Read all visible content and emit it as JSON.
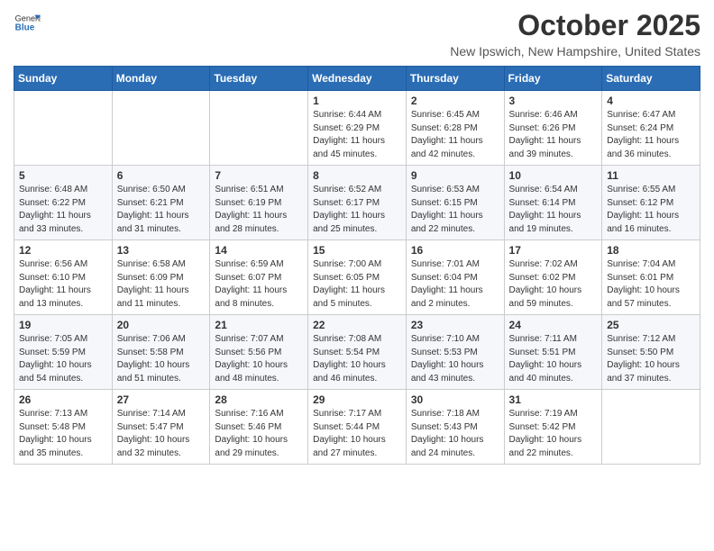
{
  "header": {
    "logo_general": "General",
    "logo_blue": "Blue",
    "month_title": "October 2025",
    "location": "New Ipswich, New Hampshire, United States"
  },
  "weekdays": [
    "Sunday",
    "Monday",
    "Tuesday",
    "Wednesday",
    "Thursday",
    "Friday",
    "Saturday"
  ],
  "weeks": [
    [
      {
        "day": "",
        "sunrise": "",
        "sunset": "",
        "daylight": ""
      },
      {
        "day": "",
        "sunrise": "",
        "sunset": "",
        "daylight": ""
      },
      {
        "day": "",
        "sunrise": "",
        "sunset": "",
        "daylight": ""
      },
      {
        "day": "1",
        "sunrise": "Sunrise: 6:44 AM",
        "sunset": "Sunset: 6:29 PM",
        "daylight": "Daylight: 11 hours and 45 minutes."
      },
      {
        "day": "2",
        "sunrise": "Sunrise: 6:45 AM",
        "sunset": "Sunset: 6:28 PM",
        "daylight": "Daylight: 11 hours and 42 minutes."
      },
      {
        "day": "3",
        "sunrise": "Sunrise: 6:46 AM",
        "sunset": "Sunset: 6:26 PM",
        "daylight": "Daylight: 11 hours and 39 minutes."
      },
      {
        "day": "4",
        "sunrise": "Sunrise: 6:47 AM",
        "sunset": "Sunset: 6:24 PM",
        "daylight": "Daylight: 11 hours and 36 minutes."
      }
    ],
    [
      {
        "day": "5",
        "sunrise": "Sunrise: 6:48 AM",
        "sunset": "Sunset: 6:22 PM",
        "daylight": "Daylight: 11 hours and 33 minutes."
      },
      {
        "day": "6",
        "sunrise": "Sunrise: 6:50 AM",
        "sunset": "Sunset: 6:21 PM",
        "daylight": "Daylight: 11 hours and 31 minutes."
      },
      {
        "day": "7",
        "sunrise": "Sunrise: 6:51 AM",
        "sunset": "Sunset: 6:19 PM",
        "daylight": "Daylight: 11 hours and 28 minutes."
      },
      {
        "day": "8",
        "sunrise": "Sunrise: 6:52 AM",
        "sunset": "Sunset: 6:17 PM",
        "daylight": "Daylight: 11 hours and 25 minutes."
      },
      {
        "day": "9",
        "sunrise": "Sunrise: 6:53 AM",
        "sunset": "Sunset: 6:15 PM",
        "daylight": "Daylight: 11 hours and 22 minutes."
      },
      {
        "day": "10",
        "sunrise": "Sunrise: 6:54 AM",
        "sunset": "Sunset: 6:14 PM",
        "daylight": "Daylight: 11 hours and 19 minutes."
      },
      {
        "day": "11",
        "sunrise": "Sunrise: 6:55 AM",
        "sunset": "Sunset: 6:12 PM",
        "daylight": "Daylight: 11 hours and 16 minutes."
      }
    ],
    [
      {
        "day": "12",
        "sunrise": "Sunrise: 6:56 AM",
        "sunset": "Sunset: 6:10 PM",
        "daylight": "Daylight: 11 hours and 13 minutes."
      },
      {
        "day": "13",
        "sunrise": "Sunrise: 6:58 AM",
        "sunset": "Sunset: 6:09 PM",
        "daylight": "Daylight: 11 hours and 11 minutes."
      },
      {
        "day": "14",
        "sunrise": "Sunrise: 6:59 AM",
        "sunset": "Sunset: 6:07 PM",
        "daylight": "Daylight: 11 hours and 8 minutes."
      },
      {
        "day": "15",
        "sunrise": "Sunrise: 7:00 AM",
        "sunset": "Sunset: 6:05 PM",
        "daylight": "Daylight: 11 hours and 5 minutes."
      },
      {
        "day": "16",
        "sunrise": "Sunrise: 7:01 AM",
        "sunset": "Sunset: 6:04 PM",
        "daylight": "Daylight: 11 hours and 2 minutes."
      },
      {
        "day": "17",
        "sunrise": "Sunrise: 7:02 AM",
        "sunset": "Sunset: 6:02 PM",
        "daylight": "Daylight: 10 hours and 59 minutes."
      },
      {
        "day": "18",
        "sunrise": "Sunrise: 7:04 AM",
        "sunset": "Sunset: 6:01 PM",
        "daylight": "Daylight: 10 hours and 57 minutes."
      }
    ],
    [
      {
        "day": "19",
        "sunrise": "Sunrise: 7:05 AM",
        "sunset": "Sunset: 5:59 PM",
        "daylight": "Daylight: 10 hours and 54 minutes."
      },
      {
        "day": "20",
        "sunrise": "Sunrise: 7:06 AM",
        "sunset": "Sunset: 5:58 PM",
        "daylight": "Daylight: 10 hours and 51 minutes."
      },
      {
        "day": "21",
        "sunrise": "Sunrise: 7:07 AM",
        "sunset": "Sunset: 5:56 PM",
        "daylight": "Daylight: 10 hours and 48 minutes."
      },
      {
        "day": "22",
        "sunrise": "Sunrise: 7:08 AM",
        "sunset": "Sunset: 5:54 PM",
        "daylight": "Daylight: 10 hours and 46 minutes."
      },
      {
        "day": "23",
        "sunrise": "Sunrise: 7:10 AM",
        "sunset": "Sunset: 5:53 PM",
        "daylight": "Daylight: 10 hours and 43 minutes."
      },
      {
        "day": "24",
        "sunrise": "Sunrise: 7:11 AM",
        "sunset": "Sunset: 5:51 PM",
        "daylight": "Daylight: 10 hours and 40 minutes."
      },
      {
        "day": "25",
        "sunrise": "Sunrise: 7:12 AM",
        "sunset": "Sunset: 5:50 PM",
        "daylight": "Daylight: 10 hours and 37 minutes."
      }
    ],
    [
      {
        "day": "26",
        "sunrise": "Sunrise: 7:13 AM",
        "sunset": "Sunset: 5:48 PM",
        "daylight": "Daylight: 10 hours and 35 minutes."
      },
      {
        "day": "27",
        "sunrise": "Sunrise: 7:14 AM",
        "sunset": "Sunset: 5:47 PM",
        "daylight": "Daylight: 10 hours and 32 minutes."
      },
      {
        "day": "28",
        "sunrise": "Sunrise: 7:16 AM",
        "sunset": "Sunset: 5:46 PM",
        "daylight": "Daylight: 10 hours and 29 minutes."
      },
      {
        "day": "29",
        "sunrise": "Sunrise: 7:17 AM",
        "sunset": "Sunset: 5:44 PM",
        "daylight": "Daylight: 10 hours and 27 minutes."
      },
      {
        "day": "30",
        "sunrise": "Sunrise: 7:18 AM",
        "sunset": "Sunset: 5:43 PM",
        "daylight": "Daylight: 10 hours and 24 minutes."
      },
      {
        "day": "31",
        "sunrise": "Sunrise: 7:19 AM",
        "sunset": "Sunset: 5:42 PM",
        "daylight": "Daylight: 10 hours and 22 minutes."
      },
      {
        "day": "",
        "sunrise": "",
        "sunset": "",
        "daylight": ""
      }
    ]
  ]
}
